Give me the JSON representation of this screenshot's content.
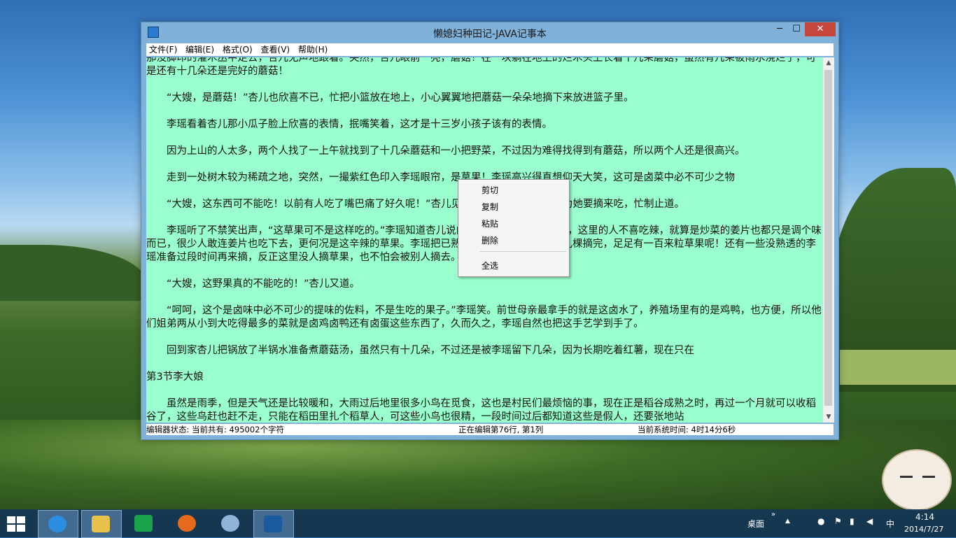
{
  "window": {
    "title": "懒媳妇种田记-JAVA记事本",
    "min_glyph": "─",
    "max_glyph": "☐",
    "close_glyph": "✕"
  },
  "menu": [
    "文件(F)",
    "编辑(E)",
    "格式(O)",
    "查看(V)",
    "帮助(H)"
  ],
  "editor": {
    "background": "#99ffcc",
    "paragraphs": [
      "那没脚印的灌木丛中走去，杏儿无声地跟着。突然，杏儿眼前一亮，蘑菇！在一块躺在地上的烂木头上长着十几朵蘑菇，虽然有几朵被雨水浇烂了，可是还有十几朵还是完好的蘑菇！",
      "",
      "　　“大嫂，是蘑菇！”杏儿也欣喜不已，忙把小篮放在地上，小心翼翼地把蘑菇一朵朵地摘下来放进篮子里。",
      "",
      "　　李瑶看着杏儿那小瓜子脸上欣喜的表情，抿嘴笑着，这才是十三岁小孩子该有的表情。",
      "",
      "　　因为上山的人太多，两个人找了一上午就找到了十几朵蘑菇和一小把野菜，不过因为难得找得到有蘑菇，所以两个人还是很高兴。",
      "",
      "　　走到一处树木较为稀疏之地，突然，一撮紫红色印入李瑶眼帘，是草果！李瑶高兴得直想仰天大笑，这可是卤菜中必不可少之物",
      "",
      "　　“大嫂，这东西可不能吃！以前有人吃了嘴巴痛了好久呢！”杏儿见李瑶在草果前蹲下，以为她要摘来吃，忙制止道。",
      "",
      "　　李瑶听了不禁笑出声，“这草果可不是这样吃的。”李瑶知道杏儿说的，这里是南方天气较热，这里的人不喜吃辣，就算是炒菜的姜片也都只是调个味而已，很少人敢连姜片也吃下去，更何况是这辛辣的草果。李瑶把已熟透的草果摘到篮子里，几棵摘完，足足有一百来粒草果呢！还有一些没熟透的李瑶准备过段时间再来摘，反正这里没人摘草果，也不怕会被别人摘去。",
      "",
      "　　“大嫂，这野果真的不能吃的！”杏儿又道。",
      "",
      "　　“呵呵，这个是卤味中必不可少的提味的佐料，不是生吃的果子。”李瑶笑。前世母亲最拿手的就是这卤水了，养殖场里有的是鸡鸭，也方便，所以他们姐弟两从小到大吃得最多的菜就是卤鸡卤鸭还有卤蛋这些东西了，久而久之，李瑶自然也把这手艺学到手了。",
      "",
      "　　回到家杏儿把锅放了半锅水准备煮蘑菇汤，虽然只有十几朵，不过还是被李瑶留下几朵，因为长期吃着红薯，现在只在",
      "",
      " 第3节李大娘",
      "",
      "　　虽然是雨季，但是天气还是比较暖和，大雨过后地里很多小鸟在觅食，这也是村民们最烦恼的事，现在正是稻谷成熟之时，再过一个月就可以收稻谷了，这些鸟赶也赶不走，只能在稻田里扎个稻草人，可这些小鸟也很精，一段时间过后都知道这些是假人，还要张地站"
    ]
  },
  "context_menu": [
    "剪切",
    "复制",
    "粘贴",
    "删除",
    "全选"
  ],
  "status": {
    "left": "编辑器状态: 当前共有: 495002个字符",
    "middle": "正在编辑第76行, 第1列",
    "right": "当前系统时间: 4时14分6秒"
  },
  "taskbar": {
    "apps": [
      "ie-icon",
      "file-explorer-icon",
      "store-icon",
      "firefox-icon",
      "chrome-icon",
      "notepad-icon"
    ],
    "desktop_label": "桌面",
    "ime": "中",
    "time": "4:14",
    "date": "2014/7/27"
  }
}
